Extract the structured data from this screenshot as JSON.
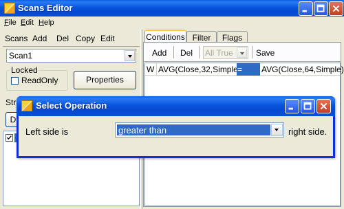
{
  "main_window": {
    "title": "Scans Editor",
    "menu": [
      {
        "label": "File",
        "accel": "F",
        "rest": "ile"
      },
      {
        "label": "Edit",
        "accel": "E",
        "rest": "dit"
      },
      {
        "label": "Help",
        "accel": "H",
        "rest": "elp"
      }
    ]
  },
  "left_panel": {
    "toolbar": [
      "Scans",
      "Add",
      "Del",
      "Copy",
      "Edit"
    ],
    "scan_select_value": "Scan1",
    "locked_group_label": "Locked",
    "readonly_label": "ReadOnly",
    "readonly_checked": false,
    "properties_button": "Properties",
    "section_label_partial": "Stra",
    "partial_button_label": "D"
  },
  "right_panel": {
    "tabs": [
      "Conditions",
      "Filter",
      "Flags"
    ],
    "active_tab": "Conditions",
    "toolbar": {
      "add": "Add",
      "del": "Del",
      "mode_select": "All True",
      "save": "Save"
    },
    "condition_row": {
      "prefix": "W",
      "left": "AVG(Close,32,Simple)",
      "operator": "=",
      "right": "AVG(Close,64,Simple)"
    }
  },
  "dialog": {
    "title": "Select Operation",
    "left_label": "Left side is",
    "operation_value": "greater than",
    "right_label": "right side."
  }
}
